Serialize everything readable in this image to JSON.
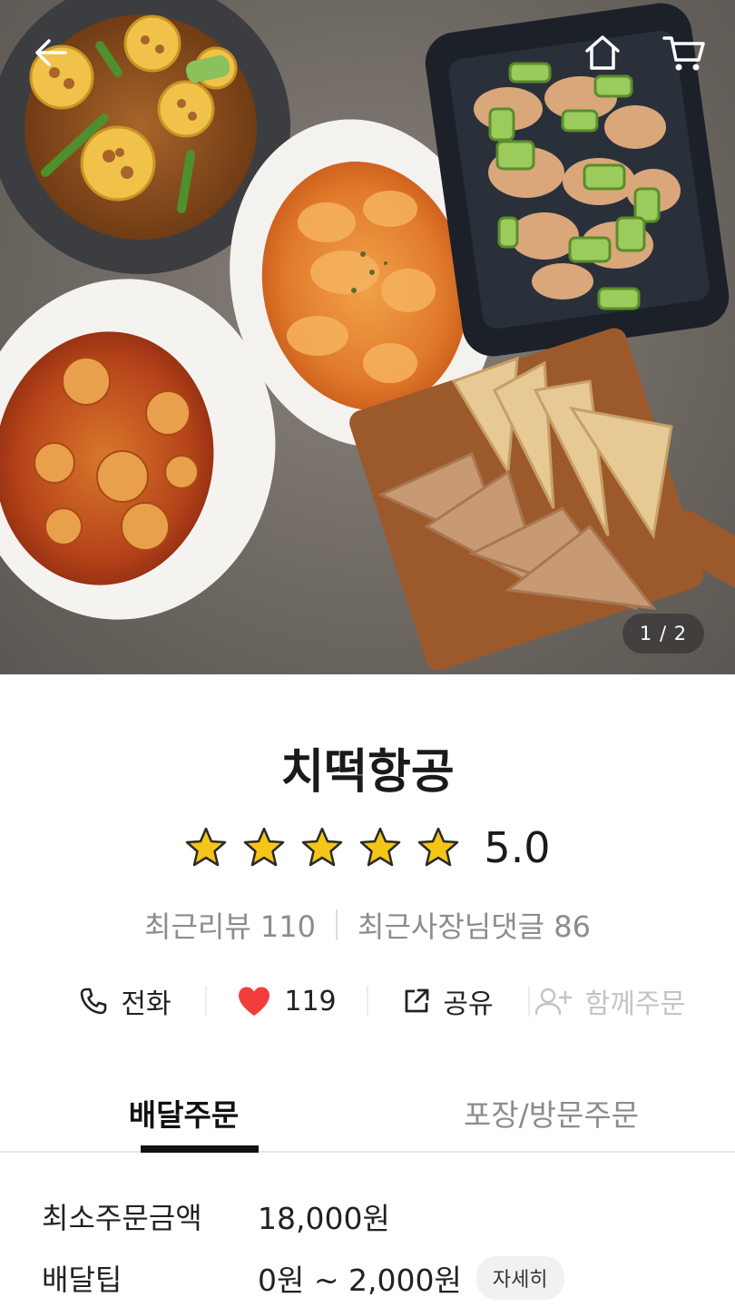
{
  "hero": {
    "page_indicator": "1 / 2",
    "icons": {
      "back": "arrow-left-icon",
      "home": "home-icon",
      "cart": "cart-icon"
    }
  },
  "store": {
    "name": "치떡항공",
    "rating": "5.0",
    "rating_stars": 5,
    "recent_reviews_label": "최근리뷰 110",
    "recent_owner_replies_label": "최근사장님댓글 86"
  },
  "actions": {
    "call": {
      "label": "전화",
      "icon": "phone-icon"
    },
    "like": {
      "label": "119",
      "icon": "heart-icon",
      "color": "#f23d3d"
    },
    "share": {
      "label": "공유",
      "icon": "share-icon"
    },
    "group_order": {
      "label": "함께주문",
      "icon": "add-user-icon"
    }
  },
  "tabs": [
    {
      "label": "배달주문",
      "active": true
    },
    {
      "label": "포장/방문주문",
      "active": false
    }
  ],
  "details": {
    "min_order": {
      "label": "최소주문금액",
      "value": "18,000원"
    },
    "delivery_tip": {
      "label": "배달팁",
      "value": "0원 ~ 2,000원",
      "button": "자세히"
    }
  },
  "colors": {
    "accent": "#111111",
    "star": "#f5c518",
    "heart": "#f23d3d"
  }
}
